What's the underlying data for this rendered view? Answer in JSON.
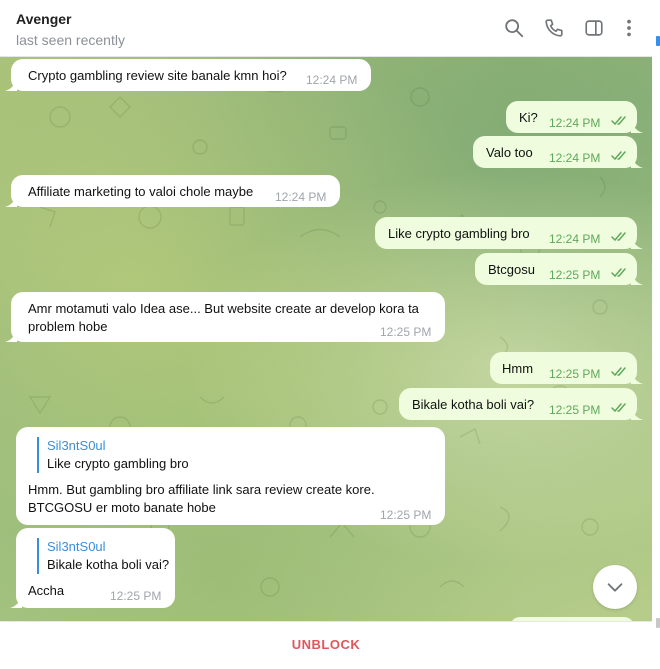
{
  "header": {
    "title": "Avenger",
    "status": "last seen recently"
  },
  "messages": [
    {
      "dir": "in",
      "text": "Crypto gambling review site banale kmn hoi?",
      "time": "12:24 PM"
    },
    {
      "dir": "out",
      "text": "Ki?",
      "time": "12:24 PM"
    },
    {
      "dir": "out",
      "text": "Valo too",
      "time": "12:24 PM"
    },
    {
      "dir": "in",
      "text": "Affiliate marketing to valoi chole maybe",
      "time": "12:24 PM"
    },
    {
      "dir": "out",
      "text": "Like crypto gambling bro",
      "time": "12:24 PM"
    },
    {
      "dir": "out",
      "text": "Btcgosu",
      "time": "12:25 PM"
    },
    {
      "dir": "in",
      "text_line1": "Amr motamuti valo Idea ase... But website create ar develop kora ta",
      "text_line2": "problem hobe",
      "time": "12:25 PM"
    },
    {
      "dir": "out",
      "text": "Hmm",
      "time": "12:25 PM"
    },
    {
      "dir": "out",
      "text": "Bikale kotha boli vai?",
      "time": "12:25 PM"
    },
    {
      "dir": "in",
      "reply_name": "Sil3ntS0ul",
      "reply_text": "Like crypto gambling bro",
      "text_line1": "Hmm. But gambling bro affiliate link sara review create kore.",
      "text_line2": "BTCGOSU er moto banate hobe",
      "time": "12:25 PM"
    },
    {
      "dir": "in",
      "reply_name": "Sil3ntS0ul",
      "reply_text": "Bikale kotha boli vai?",
      "text": "Accha",
      "time": "12:25 PM"
    }
  ],
  "footer": {
    "unblock_label": "UNBLOCK"
  },
  "icons": {
    "search": "search-icon",
    "call": "phone-icon",
    "sidebar": "sidebar-toggle-icon",
    "more": "more-vertical-icon",
    "scroll_down": "chevron-down-icon",
    "read": "double-check-icon"
  },
  "colors": {
    "incoming": "#ffffff",
    "outgoing": "#effdde",
    "accent": "#3a8fd9",
    "unblock": "#e0565b",
    "read_check": "#5fa85b"
  }
}
